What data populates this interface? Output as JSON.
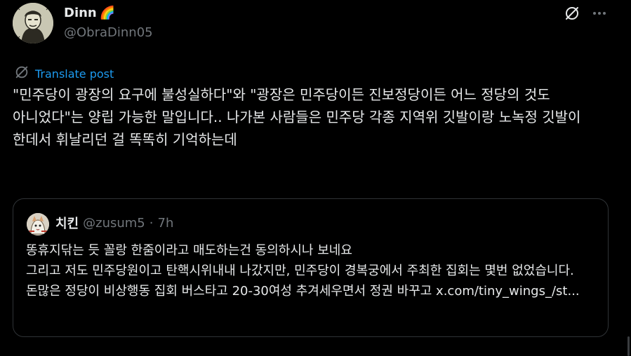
{
  "author": {
    "display_name": "Dinn",
    "emoji": "🌈",
    "handle": "@ObraDinn05"
  },
  "actions": {
    "grok_icon": "grok-icon",
    "more_icon": "more-icon"
  },
  "translate": {
    "label": "Translate post"
  },
  "post": {
    "text": "\"민주당이 광장의 요구에 불성실하다\"와 \"광장은 민주당이든 진보정당이든 어느 정당의 것도 아니었다\"는 양립 가능한 말입니다.. 나가본 사람들은 민주당 각종 지역위 깃발이랑 노녹정 깃발이 한데서 휘날리던 걸 똑똑히 기억하는데"
  },
  "quote": {
    "name": "치킨",
    "handle": "@zusum5",
    "separator": "·",
    "time": "7h",
    "line1": "똥휴지닦는 듯 꼴랑 한줌이라고 매도하는건 동의하시나 보네요",
    "line2": "그리고 저도 민주당원이고 탄핵시위내내 나갔지만, 민주당이 경복궁에서 주최한 집회는 몇번 없었습니다. 돈많은 정당이 비상행동 집회 버스타고 20-30여성 추겨세우면서 정권 바꾸고 ",
    "link": "x.com/tiny_wings_/st..."
  },
  "colors": {
    "background": "#000000",
    "text": "#e7e9ea",
    "secondary": "#71767b",
    "link": "#1d9bf0",
    "border": "#2f3336"
  }
}
